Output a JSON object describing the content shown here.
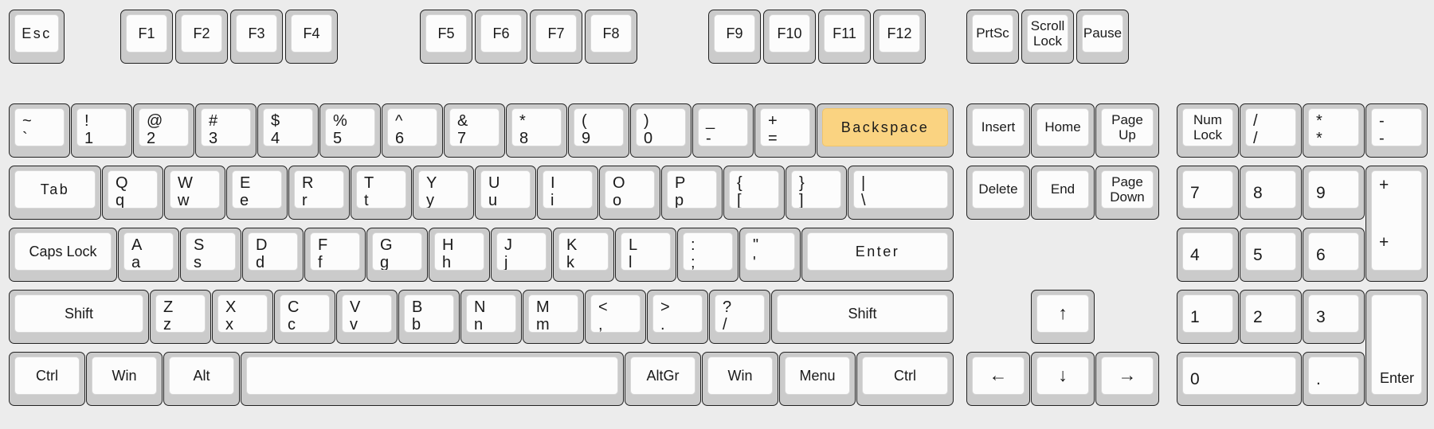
{
  "meta": {
    "title": "Full-size 104-key keyboard layout",
    "accent_color": "#fad381",
    "key_body_color": "#cbcbcb",
    "key_cap_color": "#fcfcfc",
    "background_color": "#ececec",
    "text_color": "#1a1a1a"
  },
  "function_row": {
    "escape": {
      "label": "Esc"
    },
    "group_f1_f4": [
      {
        "label": "F1"
      },
      {
        "label": "F2"
      },
      {
        "label": "F3"
      },
      {
        "label": "F4"
      }
    ],
    "group_f5_f8": [
      {
        "label": "F5"
      },
      {
        "label": "F6"
      },
      {
        "label": "F7"
      },
      {
        "label": "F8"
      }
    ],
    "group_f9_f12": [
      {
        "label": "F9"
      },
      {
        "label": "F10"
      },
      {
        "label": "F11"
      },
      {
        "label": "F12"
      }
    ],
    "system_keys": [
      {
        "label": "PrtSc"
      },
      {
        "line1": "Scroll",
        "line2": "Lock"
      },
      {
        "label": "Pause"
      }
    ]
  },
  "number_row": [
    {
      "shift": "~",
      "base": "`"
    },
    {
      "shift": "!",
      "base": "1"
    },
    {
      "shift": "@",
      "base": "2"
    },
    {
      "shift": "#",
      "base": "3"
    },
    {
      "shift": "$",
      "base": "4"
    },
    {
      "shift": "%",
      "base": "5"
    },
    {
      "shift": "^",
      "base": "6"
    },
    {
      "shift": "&",
      "base": "7"
    },
    {
      "shift": "*",
      "base": "8"
    },
    {
      "shift": "(",
      "base": "9"
    },
    {
      "shift": ")",
      "base": "0"
    },
    {
      "shift": "_",
      "base": "-"
    },
    {
      "shift": "+",
      "base": "="
    }
  ],
  "backspace": {
    "label": "Backspace",
    "highlighted": true
  },
  "tab_row": {
    "tab": {
      "label": "Tab"
    },
    "keys": [
      {
        "shift": "Q",
        "base": "q"
      },
      {
        "shift": "W",
        "base": "w"
      },
      {
        "shift": "E",
        "base": "e"
      },
      {
        "shift": "R",
        "base": "r"
      },
      {
        "shift": "T",
        "base": "t"
      },
      {
        "shift": "Y",
        "base": "y"
      },
      {
        "shift": "U",
        "base": "u"
      },
      {
        "shift": "I",
        "base": "i"
      },
      {
        "shift": "O",
        "base": "o"
      },
      {
        "shift": "P",
        "base": "p"
      },
      {
        "shift": "{",
        "base": "["
      },
      {
        "shift": "}",
        "base": "]"
      },
      {
        "shift": "|",
        "base": "\\"
      }
    ]
  },
  "home_row": {
    "caps_lock": {
      "label": "Caps Lock"
    },
    "keys": [
      {
        "shift": "A",
        "base": "a"
      },
      {
        "shift": "S",
        "base": "s"
      },
      {
        "shift": "D",
        "base": "d"
      },
      {
        "shift": "F",
        "base": "f"
      },
      {
        "shift": "G",
        "base": "g"
      },
      {
        "shift": "H",
        "base": "h"
      },
      {
        "shift": "J",
        "base": "j"
      },
      {
        "shift": "K",
        "base": "k"
      },
      {
        "shift": "L",
        "base": "l"
      },
      {
        "shift": ":",
        "base": ";"
      },
      {
        "shift": "\"",
        "base": "'"
      }
    ],
    "enter": {
      "label": "Enter"
    }
  },
  "shift_row": {
    "shift_left": {
      "label": "Shift"
    },
    "keys": [
      {
        "shift": "Z",
        "base": "z"
      },
      {
        "shift": "X",
        "base": "x"
      },
      {
        "shift": "C",
        "base": "c"
      },
      {
        "shift": "V",
        "base": "v"
      },
      {
        "shift": "B",
        "base": "b"
      },
      {
        "shift": "N",
        "base": "n"
      },
      {
        "shift": "M",
        "base": "m"
      },
      {
        "shift": "<",
        "base": ","
      },
      {
        "shift": ">",
        "base": "."
      },
      {
        "shift": "?",
        "base": "/"
      }
    ],
    "shift_right": {
      "label": "Shift"
    }
  },
  "bottom_row": {
    "ctrl_left": {
      "label": "Ctrl"
    },
    "win_left": {
      "label": "Win"
    },
    "alt_left": {
      "label": "Alt"
    },
    "space": {
      "label": ""
    },
    "altgr": {
      "label": "AltGr"
    },
    "win_right": {
      "label": "Win"
    },
    "menu": {
      "label": "Menu"
    },
    "ctrl_right": {
      "label": "Ctrl"
    }
  },
  "nav_cluster": {
    "row1": [
      {
        "label": "Insert"
      },
      {
        "label": "Home"
      },
      {
        "line1": "Page",
        "line2": "Up"
      }
    ],
    "row2": [
      {
        "label": "Delete"
      },
      {
        "label": "End"
      },
      {
        "line1": "Page",
        "line2": "Down"
      }
    ]
  },
  "arrow_cluster": {
    "up": {
      "glyph": "↑",
      "icon": "arrow-up-icon"
    },
    "left": {
      "glyph": "←",
      "icon": "arrow-left-icon"
    },
    "down": {
      "glyph": "↓",
      "icon": "arrow-down-icon"
    },
    "right": {
      "glyph": "→",
      "icon": "arrow-right-icon"
    }
  },
  "numpad": {
    "num_lock": {
      "line1": "Num",
      "line2": "Lock"
    },
    "divide": {
      "shift": "/",
      "base": "/"
    },
    "multiply": {
      "shift": "*",
      "base": "*"
    },
    "subtract": {
      "shift": "-",
      "base": "-"
    },
    "add": {
      "top": "+",
      "bottom": "+"
    },
    "enter": {
      "label": "Enter"
    },
    "digit7": {
      "label": "7"
    },
    "digit8": {
      "label": "8"
    },
    "digit9": {
      "label": "9"
    },
    "digit4": {
      "label": "4"
    },
    "digit5": {
      "label": "5"
    },
    "digit6": {
      "label": "6"
    },
    "digit1": {
      "label": "1"
    },
    "digit2": {
      "label": "2"
    },
    "digit3": {
      "label": "3"
    },
    "digit0": {
      "label": "0"
    },
    "decimal": {
      "label": "."
    }
  }
}
